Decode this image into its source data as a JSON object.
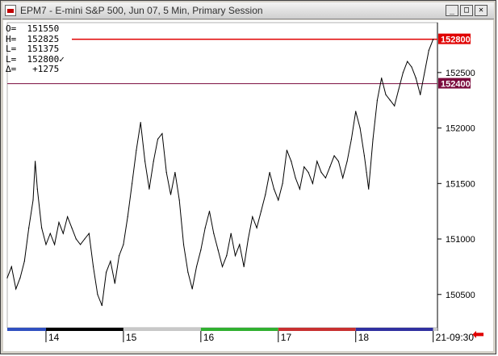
{
  "window": {
    "title": "EPM7 - E-mini S&P 500, Jun 07, 5 Min, Primary Session",
    "minimize_glyph": "_",
    "maximize_glyph": "□",
    "close_glyph": "✕"
  },
  "readout": {
    "open": "O=  151550",
    "high": "H=  152825",
    "low": "L=  151375",
    "last": "L=  152800✓",
    "delta": "∆=   +1275"
  },
  "dock_icon": "left-arrow-icon",
  "colors": {
    "line": "#000000",
    "high_line": "#e00000",
    "level_line": "#7a0a3c",
    "high_tag": "#e00000",
    "level_tag": "#7a0a3c"
  },
  "chart_data": {
    "type": "line",
    "title": "EPM7 - E-mini S&P 500, Jun 07, 5 Min, Primary Session",
    "ylim": [
      150200,
      152950
    ],
    "xlim": [
      0,
      100
    ],
    "y_ticks": [
      "152500",
      "152000",
      "151500",
      "151000",
      "150500"
    ],
    "x_ticks": [
      {
        "label": "14",
        "x": 9
      },
      {
        "label": "15",
        "x": 27
      },
      {
        "label": "16",
        "x": 45
      },
      {
        "label": "17",
        "x": 63
      },
      {
        "label": "18",
        "x": 81
      },
      {
        "label": "21-09:30",
        "x": 99
      }
    ],
    "session_bands": [
      {
        "from": 0,
        "to": 9,
        "color": "#3050c0"
      },
      {
        "from": 9,
        "to": 27,
        "color": "#000000"
      },
      {
        "from": 27,
        "to": 45,
        "color": "#c8c8c8"
      },
      {
        "from": 45,
        "to": 63,
        "color": "#30b030"
      },
      {
        "from": 63,
        "to": 81,
        "color": "#c83030"
      },
      {
        "from": 81,
        "to": 99,
        "color": "#3030a0"
      },
      {
        "from": 99,
        "to": 100,
        "color": "#c8c8c8"
      }
    ],
    "levels": [
      {
        "value": 152800,
        "label": "152800",
        "role": "high"
      },
      {
        "value": 152400,
        "label": "152400",
        "role": "level"
      }
    ],
    "series": [
      {
        "values": [
          [
            0,
            150650
          ],
          [
            1,
            150750
          ],
          [
            2,
            150550
          ],
          [
            3,
            150650
          ],
          [
            4,
            150800
          ],
          [
            5,
            151100
          ],
          [
            6,
            151350
          ],
          [
            6.5,
            151700
          ],
          [
            7,
            151450
          ],
          [
            8,
            151100
          ],
          [
            9,
            150950
          ],
          [
            10,
            151050
          ],
          [
            11,
            150950
          ],
          [
            12,
            151150
          ],
          [
            13,
            151050
          ],
          [
            14,
            151200
          ],
          [
            15,
            151100
          ],
          [
            16,
            151000
          ],
          [
            17,
            150950
          ],
          [
            18,
            151000
          ],
          [
            19,
            151050
          ],
          [
            20,
            150750
          ],
          [
            21,
            150500
          ],
          [
            22,
            150400
          ],
          [
            23,
            150700
          ],
          [
            24,
            150800
          ],
          [
            25,
            150600
          ],
          [
            26,
            150850
          ],
          [
            27,
            150950
          ],
          [
            28,
            151200
          ],
          [
            29,
            151500
          ],
          [
            30,
            151800
          ],
          [
            31,
            152050
          ],
          [
            32,
            151700
          ],
          [
            33,
            151450
          ],
          [
            34,
            151700
          ],
          [
            35,
            151900
          ],
          [
            36,
            151950
          ],
          [
            37,
            151600
          ],
          [
            38,
            151400
          ],
          [
            39,
            151600
          ],
          [
            40,
            151350
          ],
          [
            41,
            150950
          ],
          [
            42,
            150700
          ],
          [
            43,
            150550
          ],
          [
            44,
            150750
          ],
          [
            45,
            150900
          ],
          [
            46,
            151100
          ],
          [
            47,
            151250
          ],
          [
            48,
            151050
          ],
          [
            49,
            150900
          ],
          [
            50,
            150750
          ],
          [
            51,
            150850
          ],
          [
            52,
            151050
          ],
          [
            53,
            150850
          ],
          [
            54,
            150950
          ],
          [
            55,
            150750
          ],
          [
            56,
            151000
          ],
          [
            57,
            151200
          ],
          [
            58,
            151100
          ],
          [
            59,
            151250
          ],
          [
            60,
            151400
          ],
          [
            61,
            151600
          ],
          [
            62,
            151450
          ],
          [
            63,
            151350
          ],
          [
            64,
            151500
          ],
          [
            65,
            151800
          ],
          [
            66,
            151700
          ],
          [
            67,
            151550
          ],
          [
            68,
            151450
          ],
          [
            69,
            151650
          ],
          [
            70,
            151600
          ],
          [
            71,
            151500
          ],
          [
            72,
            151700
          ],
          [
            73,
            151600
          ],
          [
            74,
            151550
          ],
          [
            75,
            151650
          ],
          [
            76,
            151750
          ],
          [
            77,
            151700
          ],
          [
            78,
            151550
          ],
          [
            79,
            151700
          ],
          [
            80,
            151900
          ],
          [
            81,
            152150
          ],
          [
            82,
            152000
          ],
          [
            83,
            151750
          ],
          [
            83.5,
            151600
          ],
          [
            84,
            151450
          ],
          [
            85,
            151900
          ],
          [
            86,
            152250
          ],
          [
            87,
            152450
          ],
          [
            88,
            152300
          ],
          [
            89,
            152250
          ],
          [
            90,
            152200
          ],
          [
            91,
            152350
          ],
          [
            92,
            152500
          ],
          [
            93,
            152600
          ],
          [
            94,
            152550
          ],
          [
            95,
            152450
          ],
          [
            96,
            152300
          ],
          [
            97,
            152500
          ],
          [
            98,
            152700
          ],
          [
            99,
            152800
          ]
        ]
      }
    ]
  }
}
